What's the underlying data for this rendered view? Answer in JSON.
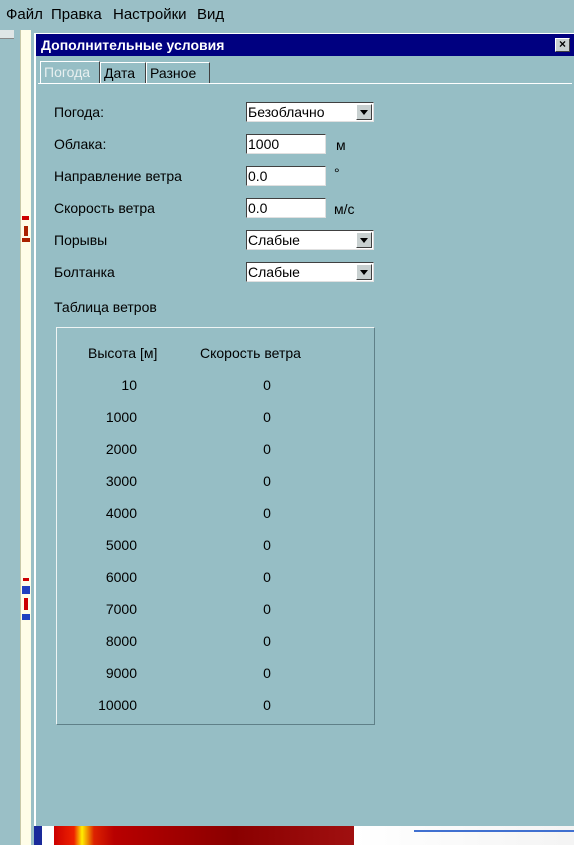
{
  "menubar": {
    "items": [
      "Файл",
      "Правка",
      "Настройки",
      "Вид"
    ]
  },
  "dialog": {
    "title": "Дополнительные условия",
    "close_label": "×",
    "tabs": [
      {
        "label": "Погода",
        "active": true
      },
      {
        "label": "Дата",
        "active": false
      },
      {
        "label": "Разное",
        "active": false
      }
    ]
  },
  "weather": {
    "weather_label": "Погода:",
    "weather_value": "Безоблачно",
    "clouds_label": "Облака:",
    "clouds_value": "1000",
    "clouds_unit": "м",
    "wind_dir_label": "Направление ветра",
    "wind_dir_value": "0.0",
    "wind_dir_unit": "°",
    "wind_speed_label": "Скорость ветра",
    "wind_speed_value": "0.0",
    "wind_speed_unit": "м/с",
    "gusts_label": "Порывы",
    "gusts_value": "Слабые",
    "turbulence_label": "Болтанка",
    "turbulence_value": "Слабые"
  },
  "wind_table": {
    "title": "Таблица ветров",
    "headers": [
      "Высота [м]",
      "Скорость ветра"
    ],
    "rows": [
      {
        "altitude": "10",
        "speed": "0"
      },
      {
        "altitude": "1000",
        "speed": "0"
      },
      {
        "altitude": "2000",
        "speed": "0"
      },
      {
        "altitude": "3000",
        "speed": "0"
      },
      {
        "altitude": "4000",
        "speed": "0"
      },
      {
        "altitude": "5000",
        "speed": "0"
      },
      {
        "altitude": "6000",
        "speed": "0"
      },
      {
        "altitude": "7000",
        "speed": "0"
      },
      {
        "altitude": "8000",
        "speed": "0"
      },
      {
        "altitude": "9000",
        "speed": "0"
      },
      {
        "altitude": "10000",
        "speed": "0"
      }
    ]
  },
  "colors": {
    "titlebar": "#000080",
    "dialog_bg": "#96bec5"
  }
}
